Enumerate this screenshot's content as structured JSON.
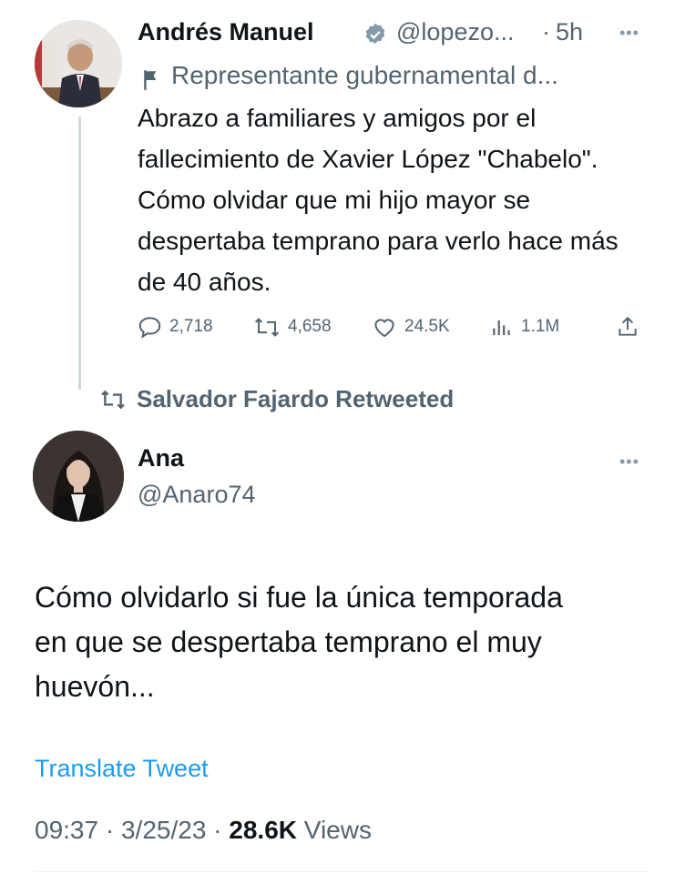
{
  "tweet1": {
    "name": "Andrés Manuel",
    "handle": "@lopezo...",
    "separator": "·",
    "time": "5h",
    "label": "Representante gubernamental d...",
    "text": "Abrazo a familiares y amigos por el fallecimiento de Xavier López \"Chabelo\". Cómo olvidar que mi hijo mayor se despertaba temprano para verlo hace más de 40 años.",
    "replies": "2,718",
    "retweets": "4,658",
    "likes": "24.5K",
    "views": "1.1M"
  },
  "retweet_banner": {
    "text": "Salvador Fajardo Retweeted"
  },
  "tweet2": {
    "name": "Ana",
    "handle": "@Anaro74",
    "text": "Cómo olvidarlo si fue la única temporada en que se despertaba temprano el muy huevón...",
    "translate": "Translate Tweet",
    "time": "09:37",
    "date": "3/25/23",
    "separator": "·",
    "views_count": "28.6K",
    "views_label": "Views"
  },
  "colors": {
    "text": "#0f1419",
    "muted": "#536471",
    "link": "#1d9bf0",
    "verified_badge": "#829aab"
  },
  "icons": [
    "reply-icon",
    "retweet-icon",
    "like-icon",
    "views-icon",
    "share-icon",
    "verified-icon",
    "flag-icon",
    "more-icon"
  ]
}
